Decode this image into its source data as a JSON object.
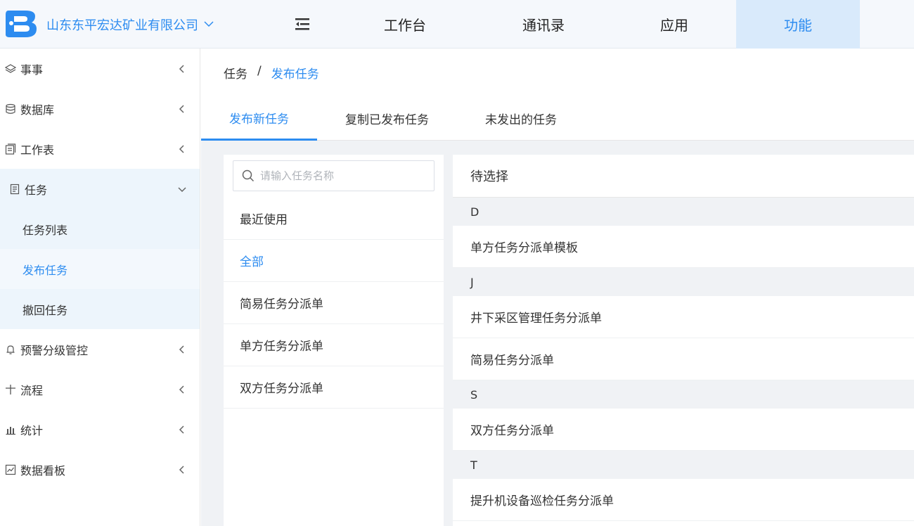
{
  "header": {
    "company": "山东东平宏达矿业有限公司",
    "nav": [
      {
        "label": "工作台",
        "active": false
      },
      {
        "label": "通讯录",
        "active": false
      },
      {
        "label": "应用",
        "active": false
      },
      {
        "label": "功能",
        "active": true
      }
    ]
  },
  "sidebar": {
    "items": [
      {
        "label": "事事",
        "icon": "layers-icon"
      },
      {
        "label": "数据库",
        "icon": "database-icon"
      },
      {
        "label": "工作表",
        "icon": "worksheet-icon"
      },
      {
        "label": "任务",
        "icon": "task-icon",
        "open": true,
        "children": [
          {
            "label": "任务列表"
          },
          {
            "label": "发布任务",
            "active": true
          },
          {
            "label": "撤回任务"
          }
        ]
      },
      {
        "label": "预警分级管控",
        "icon": "bell-icon"
      },
      {
        "label": "流程",
        "icon": "plus-icon"
      },
      {
        "label": "统计",
        "icon": "bar-chart-icon"
      },
      {
        "label": "数据看板",
        "icon": "dashboard-icon"
      }
    ]
  },
  "breadcrumb": {
    "parent": "任务",
    "sep": "/",
    "current": "发布任务"
  },
  "tabs": [
    "发布新任务",
    "复制已发布任务",
    "未发出的任务"
  ],
  "left_panel": {
    "search_placeholder": "请输入任务名称",
    "categories": [
      "最近使用",
      "全部",
      "简易任务分派单",
      "单方任务分派单",
      "双方任务分派单"
    ]
  },
  "right_panel": {
    "title": "待选择",
    "groups": [
      {
        "letter": "D",
        "items": [
          "单方任务分派单模板"
        ]
      },
      {
        "letter": "J",
        "items": [
          "井下采区管理任务分派单",
          "简易任务分派单"
        ]
      },
      {
        "letter": "S",
        "items": [
          "双方任务分派单"
        ]
      },
      {
        "letter": "T",
        "items": [
          "提升机设备巡检任务分派单"
        ]
      }
    ]
  },
  "colors": {
    "accent": "#2d8cf0",
    "active_tab_bg": "#d9eafb",
    "panel_bg": "#f0f2f5"
  }
}
